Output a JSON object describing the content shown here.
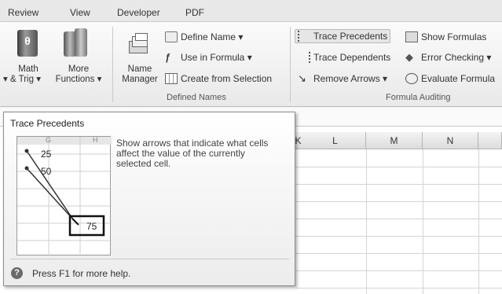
{
  "tabs": [
    "Review",
    "View",
    "Developer",
    "PDF"
  ],
  "function_library": {
    "math_label_1": "Math",
    "math_label_2": "& Trig",
    "more_label_1": "More",
    "more_label_2": "Functions",
    "math_icon_glyph": "θ"
  },
  "defined_names": {
    "name_manager_1": "Name",
    "name_manager_2": "Manager",
    "define_name": "Define Name",
    "use_in_formula": "Use in Formula",
    "create_from_selection": "Create from Selection",
    "group_label": "Defined Names"
  },
  "formula_auditing": {
    "trace_precedents": "Trace Precedents",
    "trace_dependents": "Trace Dependents",
    "remove_arrows": "Remove Arrows",
    "show_formulas": "Show Formulas",
    "error_checking": "Error Checking",
    "evaluate_formula": "Evaluate Formula",
    "group_label": "Formula Auditing"
  },
  "columns": [
    "K",
    "L",
    "M",
    "N"
  ],
  "tooltip": {
    "title": "Trace Precedents",
    "description": "Show arrows that indicate what cells affect the value of the currently selected cell.",
    "help": "Press F1 for more help.",
    "preview": {
      "col_g": "G",
      "col_h": "H",
      "value_1": "25",
      "value_2": "50",
      "value_3": "75"
    }
  },
  "colors": {
    "highlight_bg": "#e6e6e6",
    "ribbon_bg": "#f3f3f3",
    "tooltip_border": "#8e8e8e"
  }
}
